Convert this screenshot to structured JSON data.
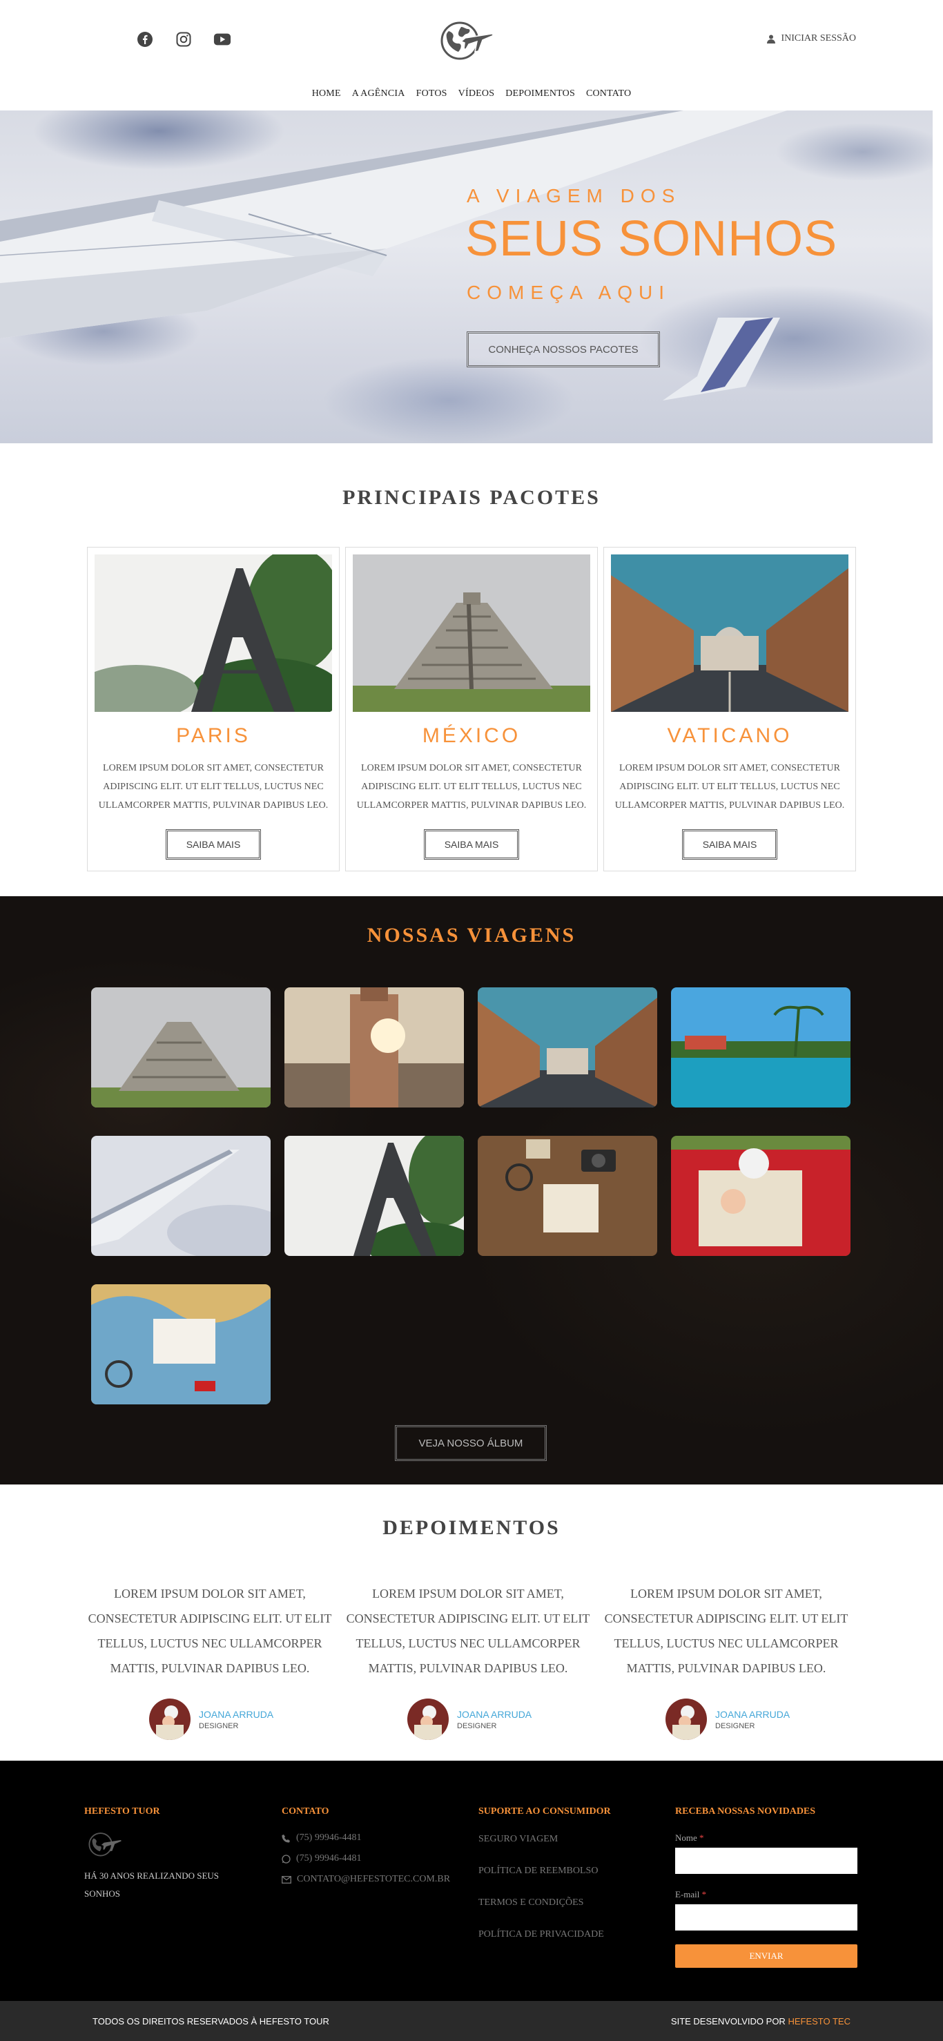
{
  "header": {
    "social": [
      {
        "icon": "facebook-icon"
      },
      {
        "icon": "instagram-icon"
      },
      {
        "icon": "youtube-icon"
      }
    ],
    "logo": "globe-plane-logo",
    "login_label": "INICIAR SESSÃO",
    "nav": [
      "HOME",
      "A AGÊNCIA",
      "FOTOS",
      "VÍDEOS",
      "DEPOIMENTOS",
      "CONTATO"
    ]
  },
  "hero": {
    "line1": "A VIAGEM DOS",
    "line2": "SEUS SONHOS",
    "line3": "COMEÇA AQUI",
    "cta": "CONHEÇA NOSSOS PACOTES"
  },
  "pacotes": {
    "title": "PRINCIPAIS PACOTES",
    "cards": [
      {
        "name": "PARIS",
        "desc": "LOREM IPSUM DOLOR SIT AMET, CONSECTETUR ADIPISCING ELIT. UT ELIT TELLUS, LUCTUS NEC ULLAMCORPER MATTIS, PULVINAR DAPIBUS LEO.",
        "button": "SAIBA MAIS"
      },
      {
        "name": "MÉXICO",
        "desc": "LOREM IPSUM DOLOR SIT AMET, CONSECTETUR ADIPISCING ELIT. UT ELIT TELLUS, LUCTUS NEC ULLAMCORPER MATTIS, PULVINAR DAPIBUS LEO.",
        "button": "SAIBA MAIS"
      },
      {
        "name": "VATICANO",
        "desc": "LOREM IPSUM DOLOR SIT AMET, CONSECTETUR ADIPISCING ELIT. UT ELIT TELLUS, LUCTUS NEC ULLAMCORPER MATTIS, PULVINAR DAPIBUS LEO.",
        "button": "SAIBA MAIS"
      }
    ]
  },
  "viagens": {
    "title": "NOSSAS VIAGENS",
    "album_button": "VEJA NOSSO ÁLBUM"
  },
  "depoimentos": {
    "title": "DEPOIMENTOS",
    "items": [
      {
        "quote": "LOREM IPSUM DOLOR SIT AMET, CONSECTETUR ADIPISCING ELIT. UT ELIT TELLUS, LUCTUS NEC ULLAMCORPER MATTIS, PULVINAR DAPIBUS LEO.",
        "name": "JOANA ARRUDA",
        "role": "DESIGNER"
      },
      {
        "quote": "LOREM IPSUM DOLOR SIT AMET, CONSECTETUR ADIPISCING ELIT. UT ELIT TELLUS, LUCTUS NEC ULLAMCORPER MATTIS, PULVINAR DAPIBUS LEO.",
        "name": "JOANA ARRUDA",
        "role": "DESIGNER"
      },
      {
        "quote": "LOREM IPSUM DOLOR SIT AMET, CONSECTETUR ADIPISCING ELIT. UT ELIT TELLUS, LUCTUS NEC ULLAMCORPER MATTIS, PULVINAR DAPIBUS LEO.",
        "name": "JOANA ARRUDA",
        "role": "DESIGNER"
      }
    ]
  },
  "footer": {
    "col1": {
      "title": "HEFESTO TUOR",
      "text": "HÁ 30 ANOS REALIZANDO SEUS SONHOS"
    },
    "col2": {
      "title": "CONTATO",
      "phone": "(75) 99946-4481",
      "whatsapp": "(75) 99946-4481",
      "email": "CONTATO@HEFESTOTEC.COM.BR"
    },
    "col3": {
      "title": "SUPORTE AO CONSUMIDOR",
      "links": [
        "SEGURO VIAGEM",
        "POLÍTICA DE REEMBOLSO",
        "TERMOS E CONDIÇÕES",
        "POLÍTICA DE PRIVACIDADE"
      ]
    },
    "col4": {
      "title": "RECEBA NOSSAS NOVIDADES",
      "name_label": "Nome",
      "email_label": "E-mail",
      "required_mark": "*",
      "button": "ENVIAR"
    }
  },
  "bottom": {
    "left": "TODOS OS DIREITOS RESERVADOS À HEFESTO TOUR",
    "right_prefix": "SITE DESENVOLVIDO POR",
    "right_brand": "HEFESTO TEC"
  },
  "colors": {
    "accent": "#f7923a",
    "link": "#45a7d8"
  }
}
